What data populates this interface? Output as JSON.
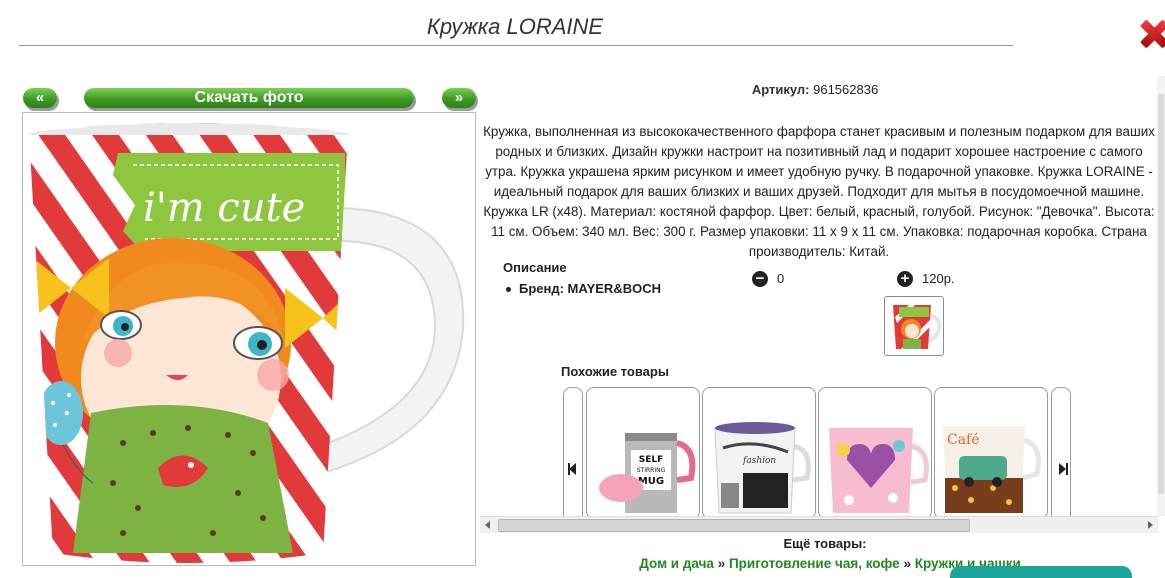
{
  "page": {
    "title": "Кружка LORAINE"
  },
  "gallery": {
    "prev_label": "«",
    "download_label": "Скачать фото",
    "next_label": "»",
    "mug_text": "i'm cute"
  },
  "product": {
    "article_label": "Артикул:",
    "article_value": "961562836",
    "description": "Кружка, выполненная из высококачественного фарфора станет красивым и полезным подарком для ваших родных и близких. Дизайн кружки настроит на позитивный лад и подарит хорошее настроение с самого утра. Кружка украшена ярким рисунком и имеет удобную ручку. В подарочной упаковке. Кружка LORAINE - идеальный подарок для ваших близких и ваших друзей. Подходит для мытья в посудомоечной машине. Кружка LR (х48). Материал: костяной фарфор. Цвет: белый, красный, голубой. Рисунок: \"Девочка\". Высота: 11 см. Объем: 340 мл. Вес: 300 г. Размер упаковки: 11 х 9 х 11 см. Упаковка: подарочная коробка. Страна производитель: Китай.",
    "description_heading": "Описание",
    "brand": "Бренд: MAYER&BOCH",
    "quantity": "0",
    "price": "120р."
  },
  "similar": {
    "heading": "Похожие товары",
    "items": [
      {
        "name": "self-stirring-mug",
        "label": "SELF STIRRING MUG"
      },
      {
        "name": "fashion-mug",
        "label": "fashion"
      },
      {
        "name": "heart-flower-mug",
        "label": ""
      },
      {
        "name": "cafe-car-mug",
        "label": "Café"
      }
    ]
  },
  "footer": {
    "more_heading": "Ещё товары:",
    "crumb1": "Дом и дача",
    "crumb2": "Приготовление чая, кофе",
    "crumb3": "Кружки и чашки",
    "separator": " » "
  },
  "colors": {
    "accent_green": "#3e9a24",
    "link_green": "#1f8a1f",
    "close_red": "#d11c1c",
    "teal": "#1aa59a"
  }
}
